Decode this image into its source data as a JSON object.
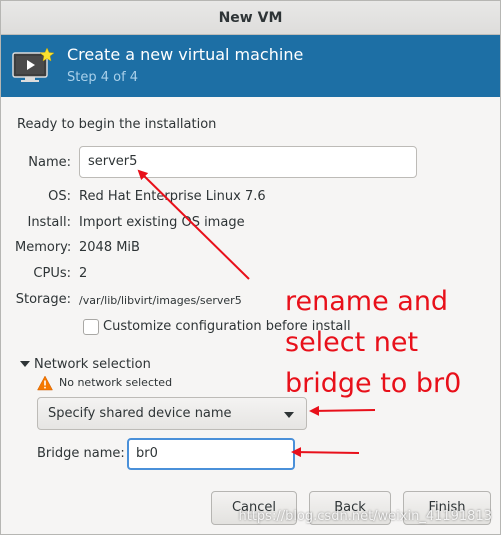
{
  "window": {
    "title": "New VM"
  },
  "header": {
    "title": "Create a new virtual machine",
    "step": "Step 4 of 4",
    "icon": "vm-monitor-icon"
  },
  "ready_text": "Ready to begin the installation",
  "details": {
    "name_label": "Name:",
    "name_value": "server5",
    "os_label": "OS:",
    "os_value": "Red Hat Enterprise Linux 7.6",
    "install_label": "Install:",
    "install_value": "Import existing OS image",
    "memory_label": "Memory:",
    "memory_value": "2048 MiB",
    "cpus_label": "CPUs:",
    "cpus_value": "2",
    "storage_label": "Storage:",
    "storage_value": "/var/lib/libvirt/images/server5"
  },
  "customize": {
    "label": "Customize configuration before install",
    "checked": false
  },
  "network": {
    "label": "Network selection",
    "warning": "No network selected",
    "selected": "Specify shared device name",
    "bridge_label": "Bridge name:",
    "bridge_value": "br0"
  },
  "buttons": {
    "cancel": "Cancel",
    "back": "Back",
    "finish": "Finish"
  },
  "annotation": {
    "lines": [
      "rename and",
      "select net",
      "bridge to br0"
    ],
    "color": "#e8101a"
  },
  "watermark": "https://blog.csdn.net/weixin_41191813",
  "colors": {
    "header_bg": "#1d6fa5",
    "focus": "#4a90d9",
    "annotation": "#e8101a"
  }
}
